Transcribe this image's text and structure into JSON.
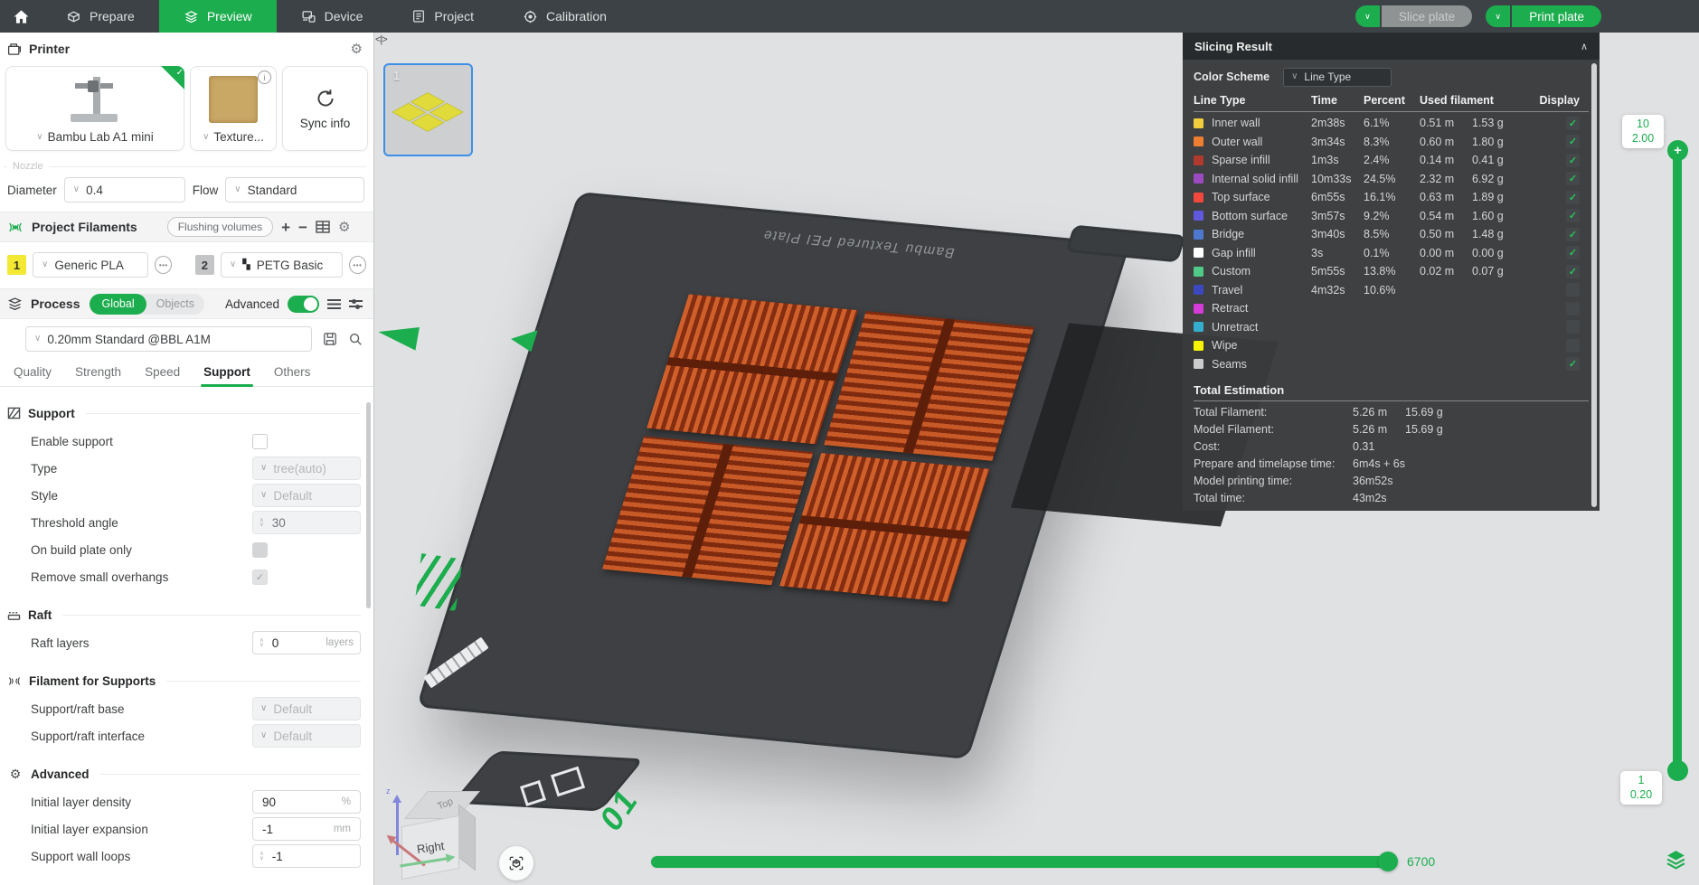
{
  "topbar": {
    "tabs": [
      {
        "label": "Prepare",
        "active": false
      },
      {
        "label": "Preview",
        "active": true
      },
      {
        "label": "Device",
        "active": false
      },
      {
        "label": "Project",
        "active": false
      },
      {
        "label": "Calibration",
        "active": false
      }
    ],
    "active_tab": "Preview",
    "slice_label": "Slice plate",
    "print_label": "Print plate"
  },
  "printer": {
    "title": "Printer",
    "machine": "Bambu Lab A1 mini",
    "plate_type": "Texture...",
    "sync_label": "Sync info",
    "nozzle_group": "Nozzle",
    "diameter_label": "Diameter",
    "diameter_value": "0.4",
    "flow_label": "Flow",
    "flow_value": "Standard"
  },
  "filaments": {
    "title": "Project Filaments",
    "flushing_label": "Flushing volumes",
    "slot1_index": "1",
    "slot1_name": "Generic PLA",
    "slot2_index": "2",
    "slot2_name": "PETG Basic"
  },
  "process": {
    "title": "Process",
    "scope_global": "Global",
    "scope_objects": "Objects",
    "scope_active": "Global",
    "advanced_label": "Advanced",
    "advanced_on": true,
    "preset": "0.20mm Standard @BBL A1M",
    "tabs": [
      "Quality",
      "Strength",
      "Speed",
      "Support",
      "Others"
    ],
    "active_tab": "Support"
  },
  "params": {
    "support_title": "Support",
    "enable_support": "Enable support",
    "enable_support_checked": false,
    "type_label": "Type",
    "type_value": "tree(auto)",
    "style_label": "Style",
    "style_value": "Default",
    "threshold_label": "Threshold angle",
    "threshold_value": "30",
    "on_build_plate": "On build plate only",
    "on_build_plate_checked": false,
    "remove_overhangs": "Remove small overhangs",
    "remove_overhangs_checked": true,
    "raft_title": "Raft",
    "raft_layers_label": "Raft layers",
    "raft_layers_value": "0",
    "raft_layers_unit": "layers",
    "filament_supports_title": "Filament for Supports",
    "raft_base_label": "Support/raft base",
    "raft_base_value": "Default",
    "raft_interface_label": "Support/raft interface",
    "raft_interface_value": "Default",
    "advanced_title": "Advanced",
    "density_label": "Initial layer density",
    "density_value": "90",
    "density_unit": "%",
    "expansion_label": "Initial layer expansion",
    "expansion_value": "-1",
    "expansion_unit": "mm",
    "wall_loops_label": "Support wall loops",
    "wall_loops_value": "-1"
  },
  "viewport": {
    "plate_thumb_number": "1",
    "plate_name": "Bambu Textured PEI Plate",
    "plate_label": "01",
    "cube_top": "Top",
    "cube_front": "Right",
    "axis_z": "z",
    "speed_value": "6700",
    "layer_top_line1": "10",
    "layer_top_line2": "2.00",
    "layer_bottom_line1": "1",
    "layer_bottom_line2": "0.20"
  },
  "panel": {
    "title": "Slicing Result",
    "color_scheme_label": "Color Scheme",
    "color_scheme_value": "Line Type",
    "col_line_type": "Line Type",
    "col_time": "Time",
    "col_percent": "Percent",
    "col_used": "Used filament",
    "col_display": "Display",
    "rows": [
      {
        "name": "Inner wall",
        "color": "#F0CE3C",
        "time": "2m38s",
        "percent": "6.1%",
        "len": "0.51 m",
        "wt": "1.53 g",
        "shown": true
      },
      {
        "name": "Outer wall",
        "color": "#EE7E31",
        "time": "3m34s",
        "percent": "8.3%",
        "len": "0.60 m",
        "wt": "1.80 g",
        "shown": true
      },
      {
        "name": "Sparse infill",
        "color": "#B03A2E",
        "time": "1m3s",
        "percent": "2.4%",
        "len": "0.14 m",
        "wt": "0.41 g",
        "shown": true
      },
      {
        "name": "Internal solid infill",
        "color": "#9C4ABF",
        "time": "10m33s",
        "percent": "24.5%",
        "len": "2.32 m",
        "wt": "6.92 g",
        "shown": true
      },
      {
        "name": "Top surface",
        "color": "#F2493C",
        "time": "6m55s",
        "percent": "16.1%",
        "len": "0.63 m",
        "wt": "1.89 g",
        "shown": true
      },
      {
        "name": "Bottom surface",
        "color": "#6059DE",
        "time": "3m57s",
        "percent": "9.2%",
        "len": "0.54 m",
        "wt": "1.60 g",
        "shown": true
      },
      {
        "name": "Bridge",
        "color": "#4C79CE",
        "time": "3m40s",
        "percent": "8.5%",
        "len": "0.50 m",
        "wt": "1.48 g",
        "shown": true
      },
      {
        "name": "Gap infill",
        "color": "#FFFFFF",
        "time": "3s",
        "percent": "0.1%",
        "len": "0.00 m",
        "wt": "0.00 g",
        "shown": true
      },
      {
        "name": "Custom",
        "color": "#4FCB87",
        "time": "5m55s",
        "percent": "13.8%",
        "len": "0.02 m",
        "wt": "0.07 g",
        "shown": true
      },
      {
        "name": "Travel",
        "color": "#3C48C0",
        "time": "4m32s",
        "percent": "10.6%",
        "len": "",
        "wt": "",
        "shown": false
      },
      {
        "name": "Retract",
        "color": "#D43BD8",
        "time": "",
        "percent": "",
        "len": "",
        "wt": "",
        "shown": false
      },
      {
        "name": "Unretract",
        "color": "#35AECD",
        "time": "",
        "percent": "",
        "len": "",
        "wt": "",
        "shown": false
      },
      {
        "name": "Wipe",
        "color": "#F5F500",
        "time": "",
        "percent": "",
        "len": "",
        "wt": "",
        "shown": false
      },
      {
        "name": "Seams",
        "color": "#CDCDCD",
        "time": "",
        "percent": "",
        "len": "",
        "wt": "",
        "shown": true
      }
    ],
    "totals_title": "Total Estimation",
    "totals": [
      {
        "label": "Total Filament:",
        "v1": "5.26 m",
        "v2": "15.69 g"
      },
      {
        "label": "Model Filament:",
        "v1": "5.26 m",
        "v2": "15.69 g"
      },
      {
        "label": "Cost:",
        "v1": "0.31",
        "v2": ""
      },
      {
        "label": "Prepare and timelapse time:",
        "v1": "6m4s + 6s",
        "v2": ""
      },
      {
        "label": "Model printing time:",
        "v1": "36m52s",
        "v2": ""
      },
      {
        "label": "Total time:",
        "v1": "43m2s",
        "v2": ""
      }
    ]
  },
  "colors": {
    "accent_green": "#1CAD4E",
    "topbar_bg": "#3C4245",
    "panel_bg": "#393B3D",
    "plate_dark": "#3E4043",
    "object_orange": "#B5482A",
    "disabled_button": "#8F9394",
    "thumb_border_blue": "#3E8FE8"
  }
}
